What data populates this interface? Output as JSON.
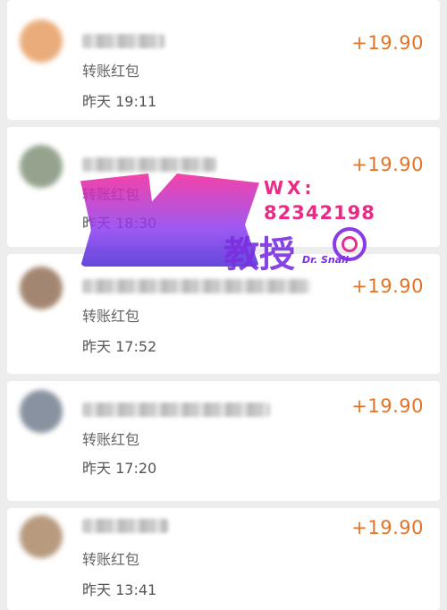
{
  "transactions": [
    {
      "type": "转账红包",
      "time": "昨天 19:11",
      "amount": "+19.90",
      "avatar_color": "#e9a46d"
    },
    {
      "type": "转账红包",
      "time": "昨天 18:30",
      "amount": "+19.90",
      "avatar_color": "#8a9a82"
    },
    {
      "type": "转账红包",
      "time": "昨天 17:52",
      "amount": "+19.90",
      "avatar_color": "#9a7a62"
    },
    {
      "type": "转账红包",
      "time": "昨天 17:20",
      "amount": "+19.90",
      "avatar_color": "#7d8796"
    },
    {
      "type": "转账红包",
      "time": "昨天 13:41",
      "amount": "+19.90",
      "avatar_color": "#b19072"
    }
  ],
  "watermark": {
    "wx": "WX:",
    "number": "82342198",
    "title": "教授",
    "brand": "Dr. Snail"
  },
  "colors": {
    "amount": "#e0742a",
    "background": "#ededed",
    "watermark_pink": "#ea2a86",
    "watermark_purple": "#7b2fe0"
  }
}
